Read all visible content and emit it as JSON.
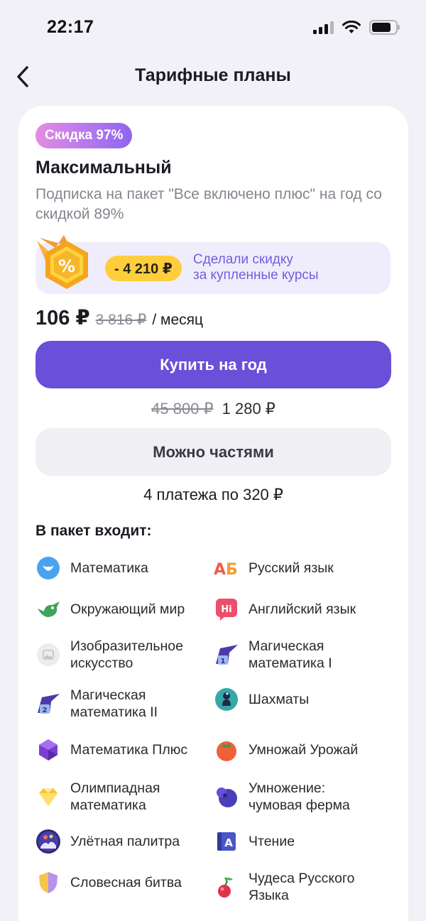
{
  "status": {
    "time": "22:17"
  },
  "nav": {
    "title": "Тарифные планы"
  },
  "plan": {
    "badge": "Скидка 97%",
    "title": "Максимальный",
    "description": "Подписка на пакет \"Все включено плюс\" на год со скидкой 89%",
    "promo": {
      "amount": "- 4 210 ₽",
      "text": "Сделали скидку\nза купленные курсы"
    },
    "price": {
      "current": "106 ₽",
      "old": "3 816 ₽",
      "period": "/ месяц"
    },
    "buy_label": "Купить на год",
    "year_price": {
      "old": "45 800 ₽",
      "new": "1 280 ₽"
    },
    "installments_label": "Можно частями",
    "installments_note": "4 платежа по 320 ₽"
  },
  "package": {
    "title": "В пакет входит:",
    "courses": [
      {
        "label": "Математика",
        "icon": "blue-bird-icon"
      },
      {
        "label": "Русский язык",
        "icon": "ab-letters-icon"
      },
      {
        "label": "Окружающий мир",
        "icon": "green-bird-icon"
      },
      {
        "label": "Английский язык",
        "icon": "hi-bubble-icon"
      },
      {
        "label": "Изобразительное\nискусство",
        "icon": "image-icon"
      },
      {
        "label": "Магическая\nматематика I",
        "icon": "wizard-hat-icon"
      },
      {
        "label": "Магическая\nматематика II",
        "icon": "wizard-hat-icon"
      },
      {
        "label": "Шахматы",
        "icon": "chess-pawn-icon"
      },
      {
        "label": "Математика Плюс",
        "icon": "crystal-icon"
      },
      {
        "label": "Умножай Урожай",
        "icon": "tomato-icon"
      },
      {
        "label": "Олимпиадная\nматематика",
        "icon": "gold-gem-icon"
      },
      {
        "label": "Умножение:\nчумовая ферма",
        "icon": "blueberry-icon"
      },
      {
        "label": "Улётная палитра",
        "icon": "palette-icon"
      },
      {
        "label": "Чтение",
        "icon": "a-book-icon"
      },
      {
        "label": "Словесная битва",
        "icon": "shield-icon"
      },
      {
        "label": "Чудеса Русского\nЯзыка",
        "icon": "cherry-icon"
      }
    ]
  },
  "colors": {
    "primary": "#6a4fd9",
    "promo_bg": "#efedfb",
    "promo_pill": "#ffce3c",
    "badge_from": "#e58be3",
    "badge_to": "#8f64f0"
  }
}
